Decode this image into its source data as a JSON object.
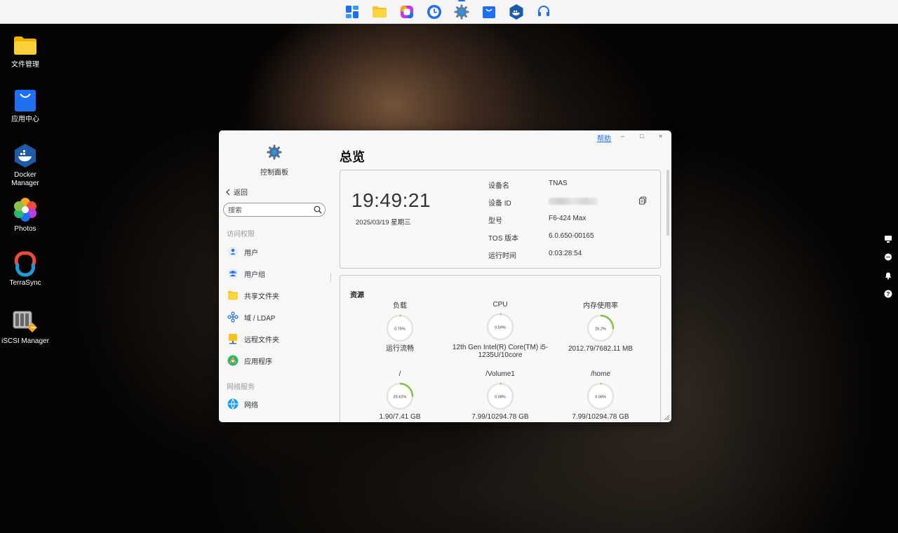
{
  "dock": {
    "items": [
      {
        "name": "app-launcher",
        "icon": "grid-icon",
        "color": "#1e6ff1"
      },
      {
        "name": "file-manager",
        "icon": "folder-icon",
        "color": "#f6c224"
      },
      {
        "name": "photos",
        "icon": "photos-icon",
        "color": "#c23ae6"
      },
      {
        "name": "backup",
        "icon": "clock-icon",
        "color": "#1e6ff1"
      },
      {
        "name": "control-panel",
        "icon": "gear-icon",
        "color": "#5b7fa6"
      },
      {
        "name": "app-center",
        "icon": "bag-icon",
        "color": "#1e6ff1"
      },
      {
        "name": "docker",
        "icon": "docker-icon",
        "color": "#1e5aa8"
      },
      {
        "name": "support",
        "icon": "headset-icon",
        "color": "#1e6ff1"
      }
    ]
  },
  "desktop": {
    "icons": [
      {
        "label": "文件管理",
        "icon": "folder-icon"
      },
      {
        "label": "应用中心",
        "icon": "bag-icon"
      },
      {
        "label": "Docker Manager",
        "icon": "docker-icon"
      },
      {
        "label": "Photos",
        "icon": "photos-flower-icon"
      },
      {
        "label": "TerraSync",
        "icon": "sync-icon"
      },
      {
        "label": "iSCSI Manager",
        "icon": "iscsi-icon"
      }
    ]
  },
  "window": {
    "help_label": "帮助",
    "controls": {
      "minimize": "–",
      "maximize": "□",
      "close": "×"
    },
    "sidebar": {
      "title": "控制面板",
      "back_label": "返回",
      "search_placeholder": "搜索",
      "section_access": "访问权限",
      "items_access": [
        {
          "label": "用户",
          "icon": "user-icon"
        },
        {
          "label": "用户组",
          "icon": "user-group-icon"
        },
        {
          "label": "共享文件夹",
          "icon": "shared-folder-icon"
        },
        {
          "label": "域 / LDAP",
          "icon": "ldap-icon"
        },
        {
          "label": "远程文件夹",
          "icon": "remote-folder-icon"
        },
        {
          "label": "应用程序",
          "icon": "application-icon"
        }
      ],
      "section_network": "网络服务",
      "items_network": [
        {
          "label": "网络",
          "icon": "network-icon"
        }
      ]
    },
    "main": {
      "title": "总览",
      "time": "19:49:21",
      "date": "2025/03/19 星期三",
      "device": {
        "name_label": "设备名",
        "name_value": "TNAS",
        "id_label": "设备 ID",
        "model_label": "型号",
        "model_value": "F6-424 Max",
        "tos_label": "TOS 版本",
        "tos_value": "6.0.650-00165",
        "uptime_label": "运行时间",
        "uptime_value": "0:03:28:54"
      },
      "resources": {
        "title": "资源",
        "items": [
          {
            "label": "负载",
            "percent_text": "0.75%",
            "percent": 0.75,
            "sub": "运行流畅"
          },
          {
            "label": "CPU",
            "percent_text": "0.59%",
            "percent": 0.59,
            "sub": "12th Gen Intel(R) Core(TM) i5-1235U/10core"
          },
          {
            "label": "内存使用率",
            "percent_text": "26.2%",
            "percent": 26.2,
            "sub": "2012.79/7682.11 MB"
          },
          {
            "label": "/",
            "percent_text": "25.62%",
            "percent": 25.62,
            "sub": "1.90/7.41 GB"
          },
          {
            "label": "/Volume1",
            "percent_text": "0.08%",
            "percent": 0.08,
            "sub": "7.99/10294.78 GB"
          },
          {
            "label": "/home",
            "percent_text": "0.08%",
            "percent": 0.08,
            "sub": "7.99/10294.78 GB"
          }
        ]
      }
    }
  },
  "colors": {
    "accent": "#1e6ff1",
    "gauge_fill": "#7dc243",
    "gauge_track": "#e3e3e3"
  }
}
